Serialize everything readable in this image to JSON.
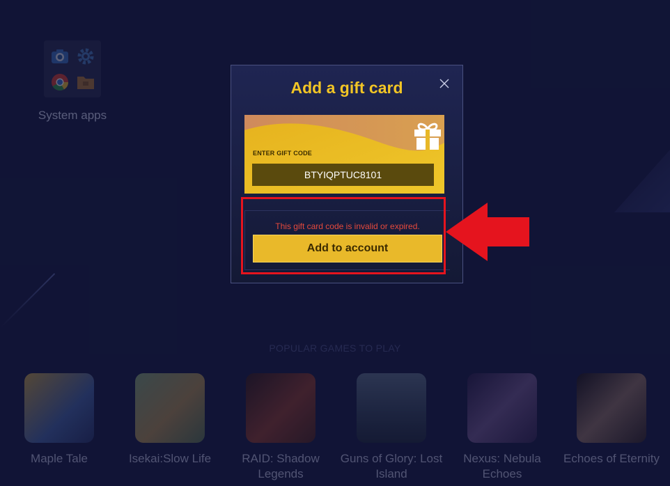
{
  "desktop": {
    "folder_label": "System apps",
    "folder_apps": [
      "camera-icon",
      "settings-icon",
      "chrome-icon",
      "files-icon"
    ]
  },
  "popular": {
    "title": "POPULAR GAMES TO PLAY",
    "games": [
      {
        "name": "Maple Tale",
        "color": "#4f79c4"
      },
      {
        "name": "Isekai:Slow Life",
        "color": "#7aa36b"
      },
      {
        "name": "RAID: Shadow Legends",
        "color": "#8a3a22"
      },
      {
        "name": "Guns of Glory: Lost Island",
        "color": "#4d6a86"
      },
      {
        "name": "Nexus: Nebula Echoes",
        "color": "#5a3e7a"
      },
      {
        "name": "Echoes of Eternity",
        "color": "#8a6a58"
      }
    ]
  },
  "modal": {
    "title": "Add a gift card",
    "close_icon": "close-icon",
    "card_label": "ENTER GIFT CODE",
    "code_value": "BTYIQPTUC8101",
    "error": "This gift card code is invalid or expired.",
    "submit_label": "Add to account"
  },
  "colors": {
    "accent": "#f2c525",
    "error": "#e6493c",
    "annotation": "#e5141e"
  }
}
